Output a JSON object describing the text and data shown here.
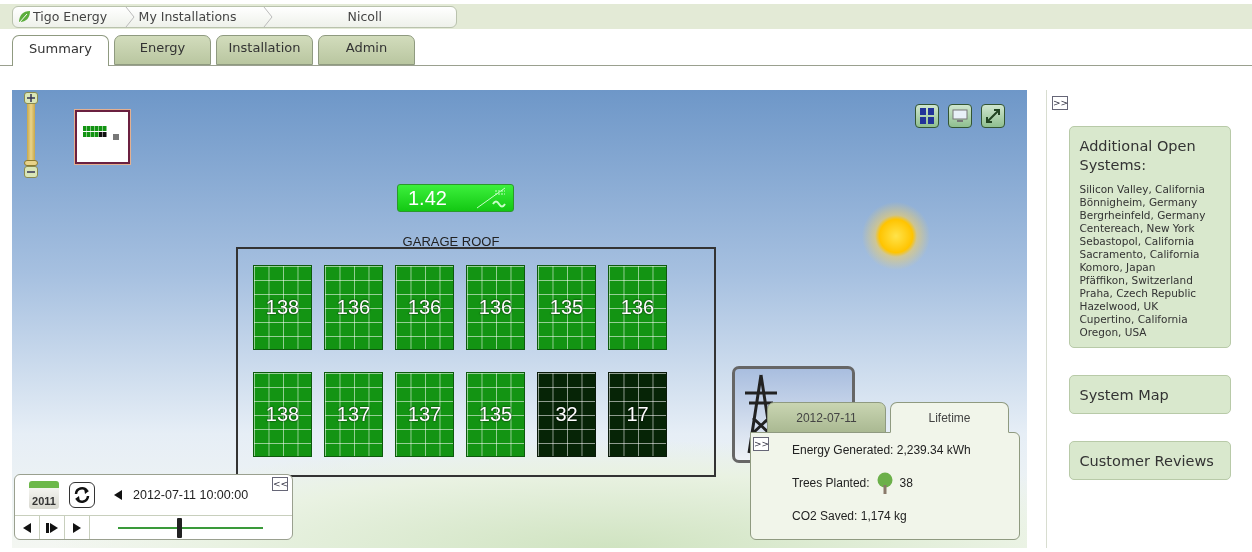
{
  "breadcrumb": [
    {
      "label": "Tigo Energy",
      "kind": "home"
    },
    {
      "label": "My Installations",
      "kind": "link"
    },
    {
      "label": "Nicoll",
      "kind": "current"
    }
  ],
  "tabs": [
    {
      "label": "Summary",
      "selected": true
    },
    {
      "label": "Energy",
      "selected": false
    },
    {
      "label": "Installation",
      "selected": false
    },
    {
      "label": "Admin",
      "selected": false
    }
  ],
  "canvas": {
    "zoom": {
      "level": 0
    },
    "power": "1.42",
    "array_label": "GARAGE ROOF",
    "panels": [
      {
        "value": "138",
        "low": false
      },
      {
        "value": "136",
        "low": false
      },
      {
        "value": "136",
        "low": false
      },
      {
        "value": "136",
        "low": false
      },
      {
        "value": "135",
        "low": false
      },
      {
        "value": "136",
        "low": false
      },
      {
        "value": "138",
        "low": false
      },
      {
        "value": "137",
        "low": false
      },
      {
        "value": "137",
        "low": false
      },
      {
        "value": "135",
        "low": false
      },
      {
        "value": "32",
        "low": true
      },
      {
        "value": "17",
        "low": true
      }
    ]
  },
  "timeline": {
    "year": "2011",
    "collapse": "<<",
    "timestamp": "2012-07-11 10:00:00",
    "level": 0.42
  },
  "stats": {
    "collapse": ">>",
    "tabs": [
      {
        "label": "2012-07-11",
        "selected": false
      },
      {
        "label": "Lifetime",
        "selected": true
      }
    ],
    "rows": [
      {
        "kind": "text",
        "label": "Energy Generated: 2,239.34 kWh"
      },
      {
        "kind": "tree",
        "label": "Trees Planted:",
        "value": "38"
      },
      {
        "kind": "text",
        "label": "CO2 Saved: 1,174 kg"
      }
    ]
  },
  "sidebar": {
    "collapse": ">>",
    "open_systems": {
      "title": "Additional Open Systems:",
      "items": [
        "Silicon Valley, California",
        "Bönnigheim, Germany",
        "Bergrheinfeld, Germany",
        "Centereach, New York",
        "Sebastopol, California",
        "Sacramento, California",
        "Komoro, Japan",
        "Pfäffikon, Switzerland",
        "Praha, Czech Republic",
        "Hazelwood, UK",
        "Cupertino, California",
        "Oregon, USA"
      ]
    },
    "links": [
      "System Map",
      "Customer Reviews"
    ]
  }
}
